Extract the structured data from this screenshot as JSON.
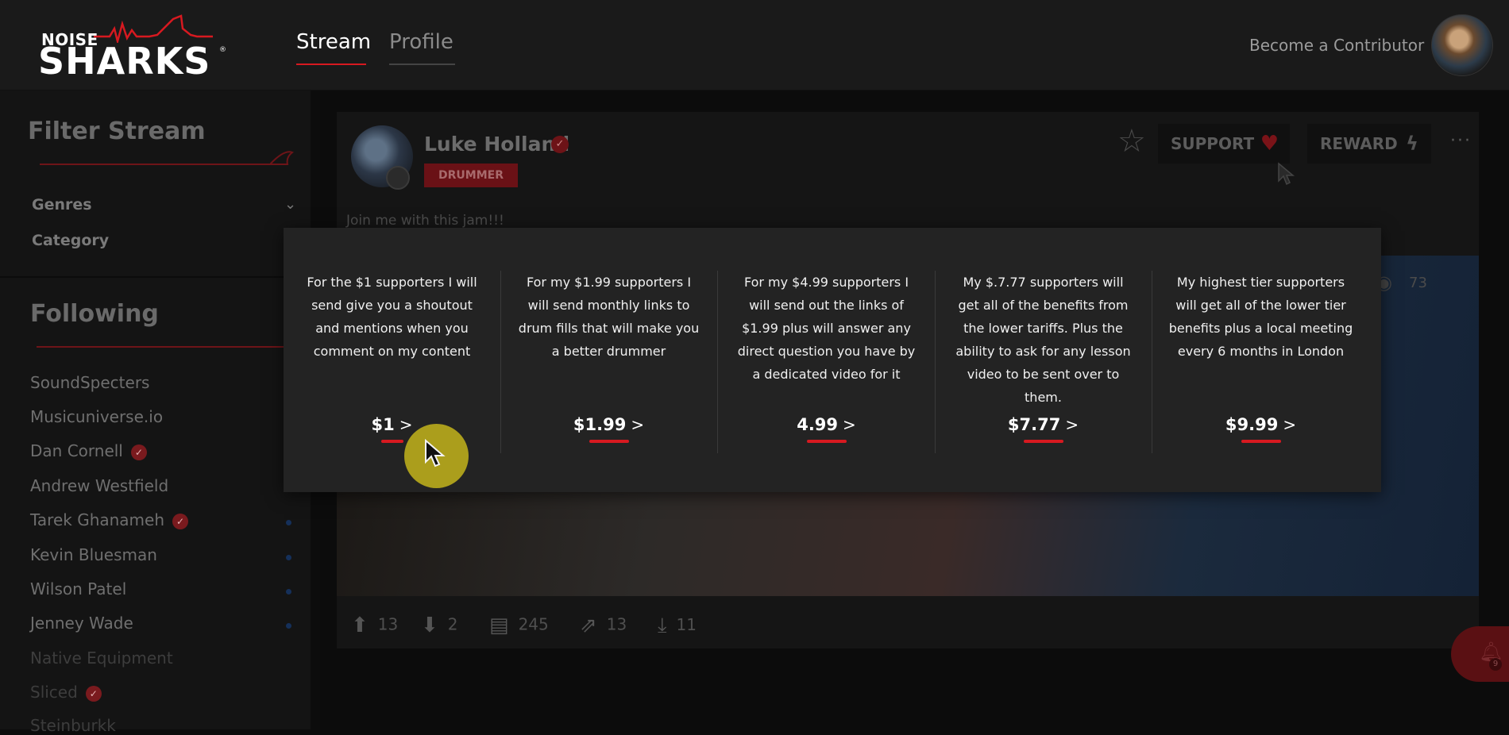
{
  "header": {
    "logo_top": "NOISE",
    "logo_main": "SHARKS",
    "logo_reg": "®",
    "tabs": [
      {
        "label": "Stream",
        "active": true
      },
      {
        "label": "Profile",
        "active": false
      }
    ],
    "become_contributor": "Become a Contributor"
  },
  "sidebar": {
    "filter_title": "Filter Stream",
    "filters": [
      {
        "label": "Genres"
      },
      {
        "label": "Category"
      }
    ],
    "following_title": "Following",
    "following": [
      {
        "name": "SoundSpecters",
        "verified": false
      },
      {
        "name": "Musicuniverse.io",
        "verified": false
      },
      {
        "name": "Dan Cornell",
        "verified": true
      },
      {
        "name": "Andrew Westfield",
        "verified": false
      },
      {
        "name": "Tarek Ghanameh",
        "verified": true
      },
      {
        "name": "Kevin Bluesman",
        "verified": false
      },
      {
        "name": "Wilson Patel",
        "verified": false
      },
      {
        "name": "Jenney Wade",
        "verified": false
      },
      {
        "name": "Native Equipment",
        "verified": false
      },
      {
        "name": "Sliced",
        "verified": true
      },
      {
        "name": "Steinburkk",
        "verified": false
      }
    ]
  },
  "post": {
    "author": "Luke Holland",
    "role_tag": "DRUMMER",
    "support_label": "SUPPORT",
    "reward_label": "REWARD",
    "more_label": "···",
    "caption": "Join me with this jam!!!",
    "views": "73",
    "stats": {
      "upvotes": "13",
      "downvotes": "2",
      "comments": "245",
      "shares": "13",
      "downloads": "11"
    }
  },
  "notifications": {
    "count": "9"
  },
  "support_tiers": [
    {
      "description": "For the $1 supporters I will send give you a shoutout and mentions when you comment on my content",
      "price": "$1"
    },
    {
      "description": "For my $1.99 supporters I will send monthly links to drum fills that will make you a better drummer",
      "price": "$1.99"
    },
    {
      "description": "For my $4.99 supporters I will send out the links of $1.99 plus will answer any direct question you have by a dedicated video for it",
      "price": "4.99"
    },
    {
      "description": "My $.7.77 supporters will get all of the benefits from the lower tariffs. Plus the ability to ask for any lesson video to be sent over to them.",
      "price": "$7.77"
    },
    {
      "description": "My highest tier supporters will get all of the lower tier benefits plus a local meeting every 6 months in London",
      "price": "$9.99"
    }
  ],
  "colors": {
    "accent": "#d71920",
    "background": "#0c0c0c",
    "popup": "#232323",
    "cursor_highlight": "#b3a51c"
  }
}
